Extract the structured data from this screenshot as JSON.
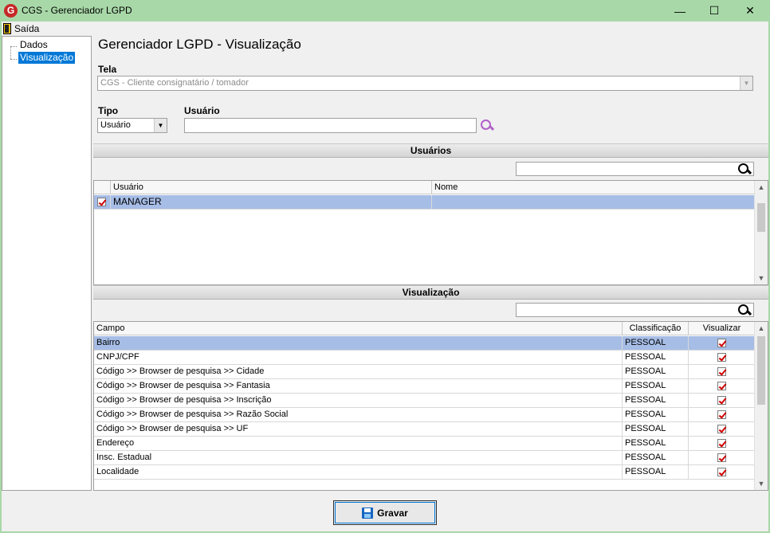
{
  "window": {
    "title": "CGS - Gerenciador LGPD",
    "logo_letter": "G",
    "minimize_glyph": "—",
    "maximize_glyph": "☐",
    "close_glyph": "✕"
  },
  "menu": {
    "saida": "Saída",
    "saida_icon": "exit-door-icon"
  },
  "tree": {
    "items": [
      "Dados",
      "Visualização"
    ],
    "selected": "Visualização"
  },
  "page": {
    "title": "Gerenciador LGPD - Visualização"
  },
  "tela": {
    "label": "Tela",
    "value": "CGS - Cliente consignatário / tomador"
  },
  "tipo": {
    "label": "Tipo",
    "value": "Usuário"
  },
  "usuario": {
    "label": "Usuário",
    "value": "",
    "search_icon": "search-icon"
  },
  "usuarios_section": {
    "title": "Usuários",
    "filter_value": "",
    "columns": [
      "Usuário",
      "Nome"
    ],
    "rows": [
      {
        "checked": true,
        "usuario": "MANAGER",
        "nome": ""
      }
    ]
  },
  "visualizacao_section": {
    "title": "Visualização",
    "filter_value": "",
    "columns": [
      "Campo",
      "Classificação",
      "Visualizar"
    ],
    "rows": [
      {
        "campo": "Bairro",
        "classificacao": "PESSOAL",
        "visualizar": true
      },
      {
        "campo": "CNPJ/CPF",
        "classificacao": "PESSOAL",
        "visualizar": true
      },
      {
        "campo": "Código >> Browser de pesquisa >> Cidade",
        "classificacao": "PESSOAL",
        "visualizar": true
      },
      {
        "campo": "Código >> Browser de pesquisa >> Fantasia",
        "classificacao": "PESSOAL",
        "visualizar": true
      },
      {
        "campo": "Código >> Browser de pesquisa >> Inscrição",
        "classificacao": "PESSOAL",
        "visualizar": true
      },
      {
        "campo": "Código >> Browser de pesquisa >> Razão Social",
        "classificacao": "PESSOAL",
        "visualizar": true
      },
      {
        "campo": "Código >> Browser de pesquisa >> UF",
        "classificacao": "PESSOAL",
        "visualizar": true
      },
      {
        "campo": "Endereço",
        "classificacao": "PESSOAL",
        "visualizar": true
      },
      {
        "campo": "Insc. Estadual",
        "classificacao": "PESSOAL",
        "visualizar": true
      },
      {
        "campo": "Localidade",
        "classificacao": "PESSOAL",
        "visualizar": true
      }
    ]
  },
  "actions": {
    "gravar": "Gravar",
    "gravar_icon": "floppy-disk-icon"
  },
  "colors": {
    "titlebar": "#a8d8a8",
    "selection_tree": "#0078d7",
    "selection_row": "#a6bde6",
    "search_icon_accent": "#b060c8",
    "check_mark": "#d00000"
  }
}
